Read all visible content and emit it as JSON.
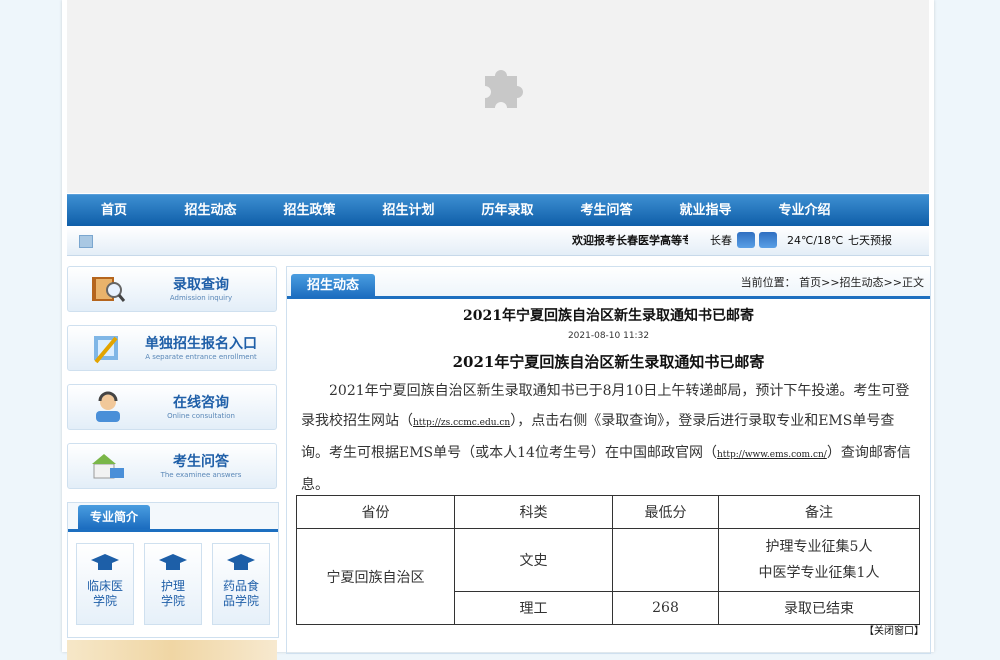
{
  "nav": [
    "首页",
    "招生动态",
    "招生政策",
    "招生计划",
    "历年录取",
    "考生问答",
    "就业指导",
    "专业介绍"
  ],
  "subbar": {
    "marquee": "欢迎报考长春医学高等专科学校",
    "city": "长春",
    "temp": "24℃/18℃",
    "forecast": "七天预报"
  },
  "sidebar": {
    "links": [
      {
        "title": "录取查询",
        "sub": "Admission inquiry",
        "icon": "book-magnifier-icon"
      },
      {
        "title": "单独招生报名入口",
        "sub": "A separate entrance enrollment",
        "icon": "pencil-doc-icon"
      },
      {
        "title": "在线咨询",
        "sub": "Online consultation",
        "icon": "support-agent-icon"
      },
      {
        "title": "考生问答",
        "sub": "The examinee answers",
        "icon": "mail-house-icon"
      }
    ],
    "majors_title": "专业简介",
    "majors": [
      {
        "line1": "临床医",
        "line2": "学院"
      },
      {
        "line1": "护理",
        "line2": "学院"
      },
      {
        "line1": "药品食",
        "line2": "品学院"
      }
    ]
  },
  "main": {
    "tab": "招生动态",
    "breadcrumb": "当前位置： 首页>>招生动态>>正文",
    "title": "2021年宁夏回族自治区新生录取通知书已邮寄",
    "date": "2021-08-10 11:32",
    "heading": "2021年宁夏回族自治区新生录取通知书已邮寄",
    "body": {
      "p1": "2021年宁夏回族自治区新生录取通知书已于8月10日上午转递邮局，预计下午投递。考生可登录我校招生网站（",
      "url1": "http://zs.ccmc.edu.cn",
      "p2": "），点击右侧《录取查询》，登录后进行录取专业和EMS单号查询。考生可根据EMS单号（或本人14位考生号）在中国邮政官网（",
      "url2": "http://www.ems.com.cn/",
      "p3": "）查询邮寄信息。"
    },
    "table": {
      "headers": [
        "省份",
        "科类",
        "最低分",
        "备注"
      ],
      "province": "宁夏回族自治区",
      "rows": [
        {
          "type": "文史",
          "min": "",
          "note1": "护理专业征集5人",
          "note2": "中医学专业征集1人"
        },
        {
          "type": "理工",
          "min": "268",
          "note1": "录取已结束"
        }
      ]
    },
    "close": "【关闭窗口】"
  },
  "colors": {
    "nav": "#0f5ea8",
    "accent": "#1d6fc0"
  }
}
